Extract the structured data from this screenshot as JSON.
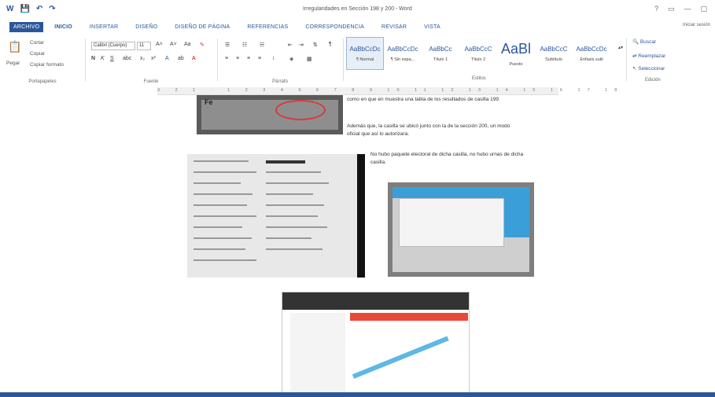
{
  "window": {
    "title": "Irregularidades en Sección 198 y 200 - Word",
    "controls": [
      "?",
      "▭",
      "—",
      "▢"
    ]
  },
  "qat": [
    "W",
    "💾",
    "↶",
    "↷"
  ],
  "tabs": [
    {
      "label": "ARCHIVO",
      "kind": "file"
    },
    {
      "label": "INICIO",
      "kind": "active"
    },
    {
      "label": "INSERTAR",
      "kind": ""
    },
    {
      "label": "DISEÑO",
      "kind": ""
    },
    {
      "label": "DISEÑO DE PÁGINA",
      "kind": ""
    },
    {
      "label": "REFERENCIAS",
      "kind": ""
    },
    {
      "label": "CORRESPONDENCIA",
      "kind": ""
    },
    {
      "label": "REVISAR",
      "kind": ""
    },
    {
      "label": "VISTA",
      "kind": ""
    }
  ],
  "signin": "Iniciar sesión",
  "ribbon": {
    "clipboard": {
      "paste": "Pegar",
      "cut": "Cortar",
      "copy": "Copiar",
      "format_painter": "Copiar formato",
      "label": "Portapapeles"
    },
    "font": {
      "name": "Calibri (Cuerpo)",
      "size": "11",
      "label": "Fuente"
    },
    "paragraph": {
      "label": "Párrafo"
    },
    "styles": {
      "label": "Estilos",
      "items": [
        {
          "sample": "AaBbCcDc",
          "name": "¶ Normal"
        },
        {
          "sample": "AaBbCcDc",
          "name": "¶ Sin espa..."
        },
        {
          "sample": "AaBbCc",
          "name": "Título 1"
        },
        {
          "sample": "AaBbCcC",
          "name": "Título 2"
        },
        {
          "sample": "AaBl",
          "name": "Puesto"
        },
        {
          "sample": "AaBbCcC",
          "name": "Subtítulo"
        },
        {
          "sample": "AaBbCcDc",
          "name": "Énfasis sutil"
        }
      ]
    },
    "editing": {
      "find": "Buscar",
      "replace": "Reemplazar",
      "select": "Seleccionar",
      "label": "Edición"
    }
  },
  "ruler": "3 2 1 · 1 2 3 4 5 6 7 8 9 10 11 12 13 14 15 16 17 18",
  "document": {
    "para1": "como en que en muestra una tabla de los resultados de casilla 199",
    "para2": "Además que, la casilla se ubicó junto con la de la sección 200, un modo oficial que así lo autorizara.",
    "para3": "No hubo paquete electoral de dicha casilla, no hubo urnas de dicha casilla.",
    "top_image_text": "Fe"
  }
}
